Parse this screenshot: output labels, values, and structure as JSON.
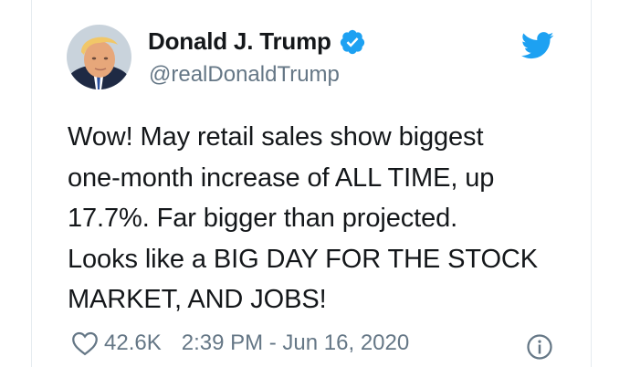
{
  "tweet": {
    "display_name": "Donald J. Trump",
    "handle": "@realDonaldTrump",
    "text": "Wow! May retail sales show biggest\none-month increase of ALL TIME, up\n17.7%. Far bigger than projected.\nLooks like a BIG DAY FOR THE STOCK\nMARKET, AND JOBS!",
    "likes": "42.6K",
    "timestamp": "2:39 PM - Jun 16, 2020"
  },
  "icons": {
    "verified": "verified-badge-icon",
    "platform": "twitter-bird-icon",
    "like": "heart-icon",
    "info": "info-icon"
  },
  "colors": {
    "accent": "#1da1f2",
    "text": "#14171a",
    "secondary": "#657786"
  }
}
